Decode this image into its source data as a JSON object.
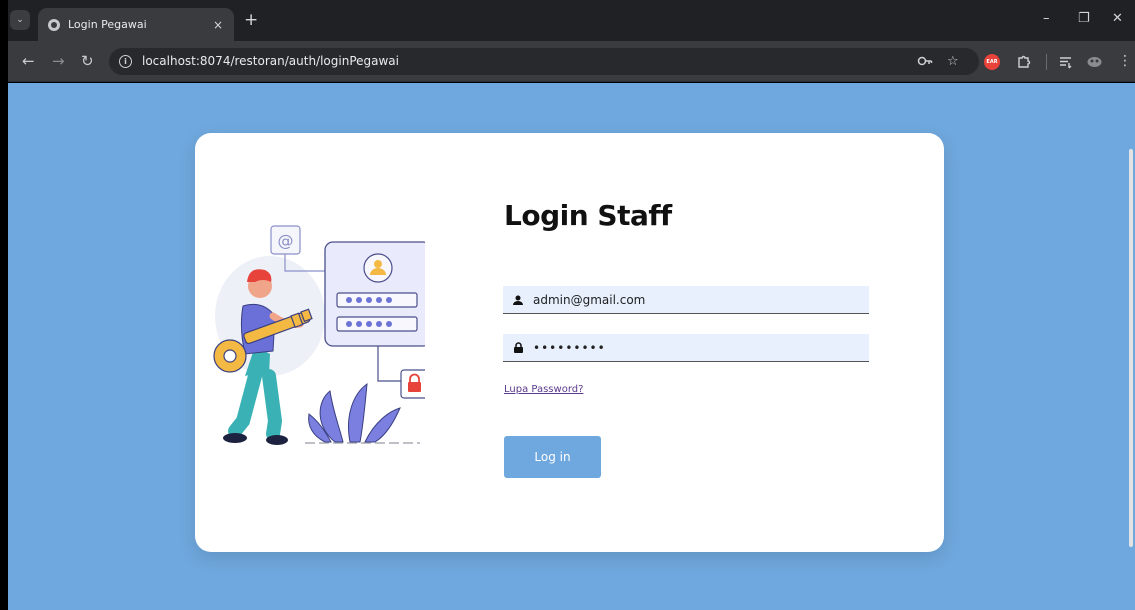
{
  "browser": {
    "tab_title": "Login Pegawai",
    "tab_close": "×",
    "new_tab": "+",
    "tab_menu": "⌄",
    "url": "localhost:8074/restoran/auth/loginPegawai",
    "site_info": "i",
    "back": "←",
    "forward": "→",
    "reload": "↻",
    "extension_badge": "EAR",
    "win_minimize": "–",
    "win_restore": "❐",
    "win_close": "✕"
  },
  "login": {
    "title": "Login Staff",
    "email_value": "admin@gmail.com",
    "password_value": "•••••••••",
    "forgot_label": "Lupa Password?",
    "login_button": "Log in"
  },
  "colors": {
    "page_background": "#6fa8de",
    "card_background": "#ffffff",
    "input_background": "#e8f0fe",
    "button": "#6fa8de",
    "link": "#5b3a8c"
  },
  "icons": {
    "email_field": "user-icon",
    "password_field": "lock-icon",
    "illustration": "person-with-key-login-illustration"
  }
}
